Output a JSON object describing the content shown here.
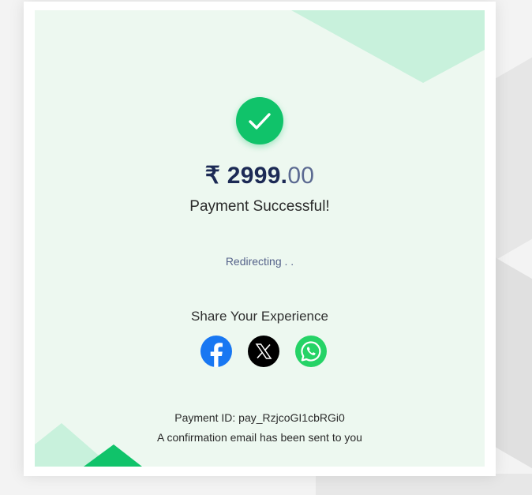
{
  "payment": {
    "currency_symbol": "₹",
    "amount_whole": "2999.",
    "amount_decimal": "00",
    "status_text": "Payment Successful!",
    "redirect_text": "Redirecting . .",
    "payment_id_label": "Payment ID: pay_RzjcoGI1cbRGi0",
    "confirmation_text": "A confirmation email has been sent to you"
  },
  "share": {
    "title": "Share Your Experience",
    "buttons": [
      {
        "name": "facebook",
        "icon": "facebook-icon",
        "color": "#1877f2"
      },
      {
        "name": "x",
        "icon": "x-icon",
        "color": "#000000"
      },
      {
        "name": "whatsapp",
        "icon": "whatsapp-icon",
        "color": "#25d366"
      }
    ]
  },
  "theme": {
    "success_green": "#10c36a",
    "panel_background": "#edf8f0",
    "amount_color": "#1c2a55"
  }
}
